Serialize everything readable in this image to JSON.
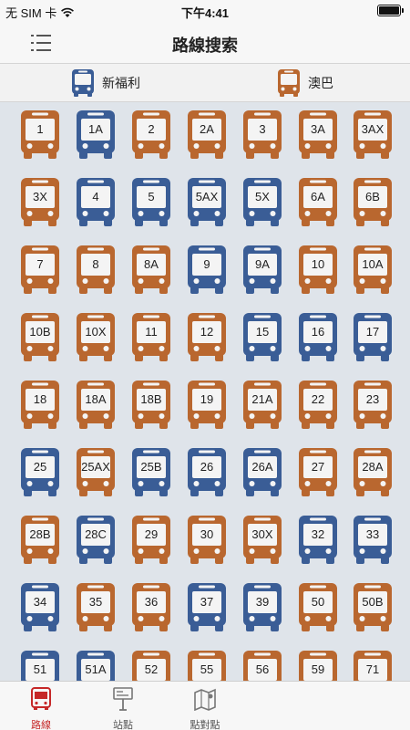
{
  "status_bar": {
    "carrier": "无 SIM 卡",
    "time": "下午4:41"
  },
  "header": {
    "title": "路線搜索"
  },
  "bus_types": [
    {
      "label": "新福利",
      "color": "#3a5d96"
    },
    {
      "label": "澳巴",
      "color": "#b9672f"
    }
  ],
  "colors": {
    "blue": "#3a5d96",
    "orange": "#b9672f",
    "active_tab": "#c62828"
  },
  "routes": [
    {
      "label": "1",
      "operator": "orange"
    },
    {
      "label": "1A",
      "operator": "blue"
    },
    {
      "label": "2",
      "operator": "orange"
    },
    {
      "label": "2A",
      "operator": "orange"
    },
    {
      "label": "3",
      "operator": "orange"
    },
    {
      "label": "3A",
      "operator": "orange"
    },
    {
      "label": "3AX",
      "operator": "orange"
    },
    {
      "label": "3X",
      "operator": "orange"
    },
    {
      "label": "4",
      "operator": "blue"
    },
    {
      "label": "5",
      "operator": "blue"
    },
    {
      "label": "5AX",
      "operator": "blue"
    },
    {
      "label": "5X",
      "operator": "blue"
    },
    {
      "label": "6A",
      "operator": "orange"
    },
    {
      "label": "6B",
      "operator": "orange"
    },
    {
      "label": "7",
      "operator": "orange"
    },
    {
      "label": "8",
      "operator": "orange"
    },
    {
      "label": "8A",
      "operator": "orange"
    },
    {
      "label": "9",
      "operator": "blue"
    },
    {
      "label": "9A",
      "operator": "blue"
    },
    {
      "label": "10",
      "operator": "orange"
    },
    {
      "label": "10A",
      "operator": "orange"
    },
    {
      "label": "10B",
      "operator": "orange"
    },
    {
      "label": "10X",
      "operator": "orange"
    },
    {
      "label": "11",
      "operator": "orange"
    },
    {
      "label": "12",
      "operator": "orange"
    },
    {
      "label": "15",
      "operator": "blue"
    },
    {
      "label": "16",
      "operator": "blue"
    },
    {
      "label": "17",
      "operator": "blue"
    },
    {
      "label": "18",
      "operator": "orange"
    },
    {
      "label": "18A",
      "operator": "orange"
    },
    {
      "label": "18B",
      "operator": "orange"
    },
    {
      "label": "19",
      "operator": "orange"
    },
    {
      "label": "21A",
      "operator": "orange"
    },
    {
      "label": "22",
      "operator": "orange"
    },
    {
      "label": "23",
      "operator": "orange"
    },
    {
      "label": "25",
      "operator": "blue"
    },
    {
      "label": "25AX",
      "operator": "orange"
    },
    {
      "label": "25B",
      "operator": "blue"
    },
    {
      "label": "26",
      "operator": "blue"
    },
    {
      "label": "26A",
      "operator": "blue"
    },
    {
      "label": "27",
      "operator": "orange"
    },
    {
      "label": "28A",
      "operator": "orange"
    },
    {
      "label": "28B",
      "operator": "orange"
    },
    {
      "label": "28C",
      "operator": "blue"
    },
    {
      "label": "29",
      "operator": "orange"
    },
    {
      "label": "30",
      "operator": "orange"
    },
    {
      "label": "30X",
      "operator": "orange"
    },
    {
      "label": "32",
      "operator": "blue"
    },
    {
      "label": "33",
      "operator": "blue"
    },
    {
      "label": "34",
      "operator": "blue"
    },
    {
      "label": "35",
      "operator": "orange"
    },
    {
      "label": "36",
      "operator": "orange"
    },
    {
      "label": "37",
      "operator": "blue"
    },
    {
      "label": "39",
      "operator": "blue"
    },
    {
      "label": "50",
      "operator": "orange"
    },
    {
      "label": "50B",
      "operator": "orange"
    },
    {
      "label": "51",
      "operator": "blue"
    },
    {
      "label": "51A",
      "operator": "blue"
    },
    {
      "label": "52",
      "operator": "orange"
    },
    {
      "label": "55",
      "operator": "orange"
    },
    {
      "label": "56",
      "operator": "orange"
    },
    {
      "label": "59",
      "operator": "orange"
    },
    {
      "label": "71",
      "operator": "orange"
    }
  ],
  "tabs": [
    {
      "label": "路線",
      "icon": "bus-icon",
      "active": true
    },
    {
      "label": "站點",
      "icon": "bus-stop-icon",
      "active": false
    },
    {
      "label": "點對點",
      "icon": "map-icon",
      "active": false
    }
  ]
}
